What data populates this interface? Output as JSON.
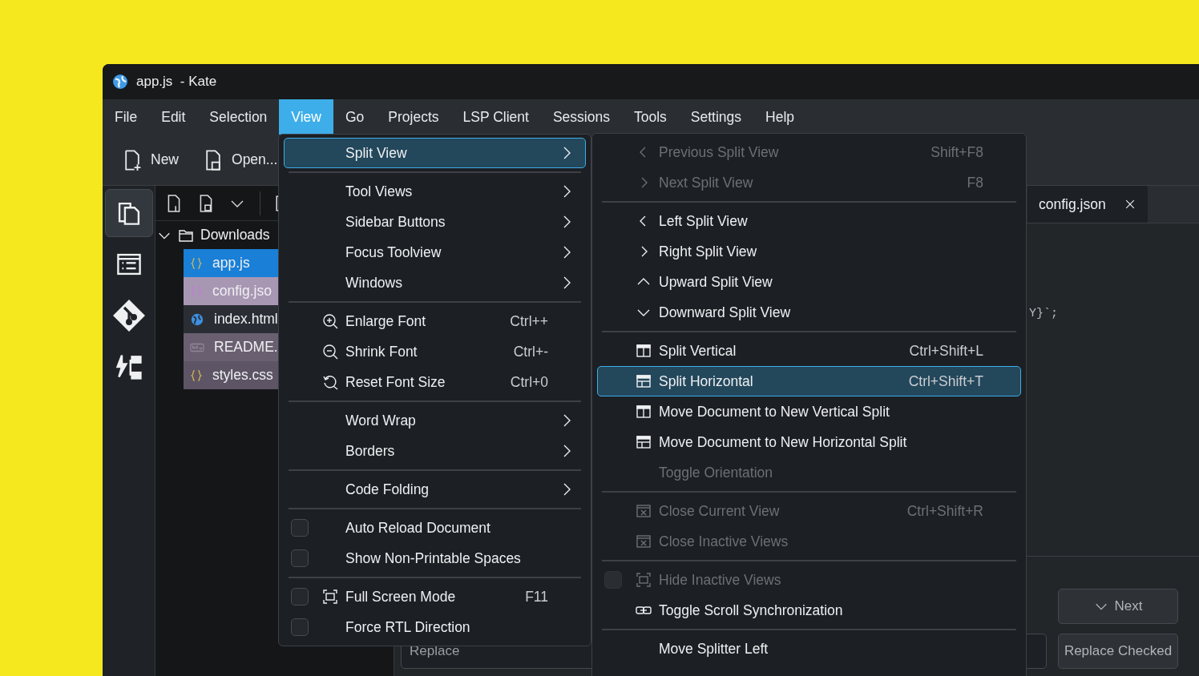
{
  "window": {
    "title": "app.js  - Kate"
  },
  "menu_bar": [
    {
      "label": "File",
      "selected": false
    },
    {
      "label": "Edit",
      "selected": false
    },
    {
      "label": "Selection",
      "selected": false
    },
    {
      "label": "View",
      "selected": true
    },
    {
      "label": "Go",
      "selected": false
    },
    {
      "label": "Projects",
      "selected": false
    },
    {
      "label": "LSP Client",
      "selected": false
    },
    {
      "label": "Sessions",
      "selected": false
    },
    {
      "label": "Tools",
      "selected": false
    },
    {
      "label": "Settings",
      "selected": false
    },
    {
      "label": "Help",
      "selected": false
    }
  ],
  "toolbar": [
    {
      "label": "New"
    },
    {
      "label": "Open..."
    }
  ],
  "sidebar": [
    {
      "selected": true
    },
    {
      "selected": false
    },
    {
      "selected": false
    },
    {
      "selected": false
    }
  ],
  "file_tree": [
    {
      "label": "Downloads",
      "kind": "folder",
      "expanded": true,
      "children": [
        {
          "label": "app.js",
          "kind": "js",
          "color": "#1a7fd6"
        },
        {
          "label": "config.jso",
          "kind": "json",
          "color": "#a897b3"
        },
        {
          "label": "index.html",
          "kind": "html",
          "color": "#2a2e34"
        },
        {
          "label": "README.",
          "kind": "md",
          "color": "#6a5f70"
        },
        {
          "label": "styles.css",
          "kind": "css",
          "color": "#5d5565"
        }
      ]
    }
  ],
  "tabs": [
    {
      "label": "config.json",
      "selected": false
    }
  ],
  "code_line": "Y}`;",
  "search_panel": {
    "replace_placeholder": "Replace",
    "buttons": [
      {
        "label": "Next"
      },
      {
        "label": "Replace Checked"
      }
    ]
  },
  "view_menu": {
    "items": [
      {
        "kind": "submenu",
        "label": "Split View",
        "selected": true
      },
      {
        "kind": "separator"
      },
      {
        "kind": "submenu",
        "label": "Tool Views",
        "selected": false
      },
      {
        "kind": "submenu",
        "label": "Sidebar Buttons",
        "selected": false
      },
      {
        "kind": "submenu",
        "label": "Focus Toolview",
        "selected": false
      },
      {
        "kind": "submenu",
        "label": "Windows",
        "selected": false
      },
      {
        "kind": "separator"
      },
      {
        "kind": "action",
        "label": "Enlarge Font",
        "shortcut": "Ctrl++",
        "selected": false
      },
      {
        "kind": "action",
        "label": "Shrink Font",
        "shortcut": "Ctrl+-",
        "selected": false
      },
      {
        "kind": "action",
        "label": "Reset Font Size",
        "shortcut": "Ctrl+0",
        "selected": false
      },
      {
        "kind": "separator"
      },
      {
        "kind": "submenu",
        "label": "Word Wrap",
        "selected": false
      },
      {
        "kind": "submenu",
        "label": "Borders",
        "selected": false
      },
      {
        "kind": "separator"
      },
      {
        "kind": "submenu",
        "label": "Code Folding",
        "selected": false
      },
      {
        "kind": "separator"
      },
      {
        "kind": "checkbox",
        "label": "Auto Reload Document",
        "checked": false,
        "selected": false
      },
      {
        "kind": "checkbox",
        "label": "Show Non-Printable Spaces",
        "checked": false,
        "selected": false
      },
      {
        "kind": "separator"
      },
      {
        "kind": "checkbox",
        "label": "Full Screen Mode",
        "shortcut": "F11",
        "checked": false,
        "selected": false
      },
      {
        "kind": "checkbox",
        "label": "Force RTL Direction",
        "checked": false,
        "selected": false
      }
    ]
  },
  "split_view_menu": {
    "items": [
      {
        "kind": "action",
        "label": "Previous Split View",
        "shortcut": "Shift+F8",
        "disabled": true,
        "selected": false
      },
      {
        "kind": "action",
        "label": "Next Split View",
        "shortcut": "F8",
        "disabled": true,
        "selected": false
      },
      {
        "kind": "separator"
      },
      {
        "kind": "action",
        "label": "Left Split View",
        "disabled": false,
        "selected": false
      },
      {
        "kind": "action",
        "label": "Right Split View",
        "disabled": false,
        "selected": false
      },
      {
        "kind": "action",
        "label": "Upward Split View",
        "disabled": false,
        "selected": false
      },
      {
        "kind": "action",
        "label": "Downward Split View",
        "disabled": false,
        "selected": false
      },
      {
        "kind": "separator"
      },
      {
        "kind": "action",
        "label": "Split Vertical",
        "shortcut": "Ctrl+Shift+L",
        "disabled": false,
        "selected": false
      },
      {
        "kind": "action",
        "label": "Split Horizontal",
        "shortcut": "Ctrl+Shift+T",
        "disabled": false,
        "selected": true
      },
      {
        "kind": "action",
        "label": "Move Document to New Vertical Split",
        "disabled": false,
        "selected": false
      },
      {
        "kind": "action",
        "label": "Move Document to New Horizontal Split",
        "disabled": false,
        "selected": false
      },
      {
        "kind": "action",
        "label": "Toggle Orientation",
        "disabled": true,
        "selected": false
      },
      {
        "kind": "separator"
      },
      {
        "kind": "action",
        "label": "Close Current View",
        "shortcut": "Ctrl+Shift+R",
        "disabled": true,
        "selected": false
      },
      {
        "kind": "action",
        "label": "Close Inactive Views",
        "disabled": true,
        "selected": false
      },
      {
        "kind": "separator"
      },
      {
        "kind": "checkbox",
        "label": "Hide Inactive Views",
        "checked": false,
        "disabled": true,
        "selected": false
      },
      {
        "kind": "action",
        "label": "Toggle Scroll Synchronization",
        "disabled": false,
        "selected": false
      },
      {
        "kind": "separator"
      },
      {
        "kind": "action",
        "label": "Move Splitter Left",
        "disabled": false,
        "selected": false
      }
    ]
  }
}
